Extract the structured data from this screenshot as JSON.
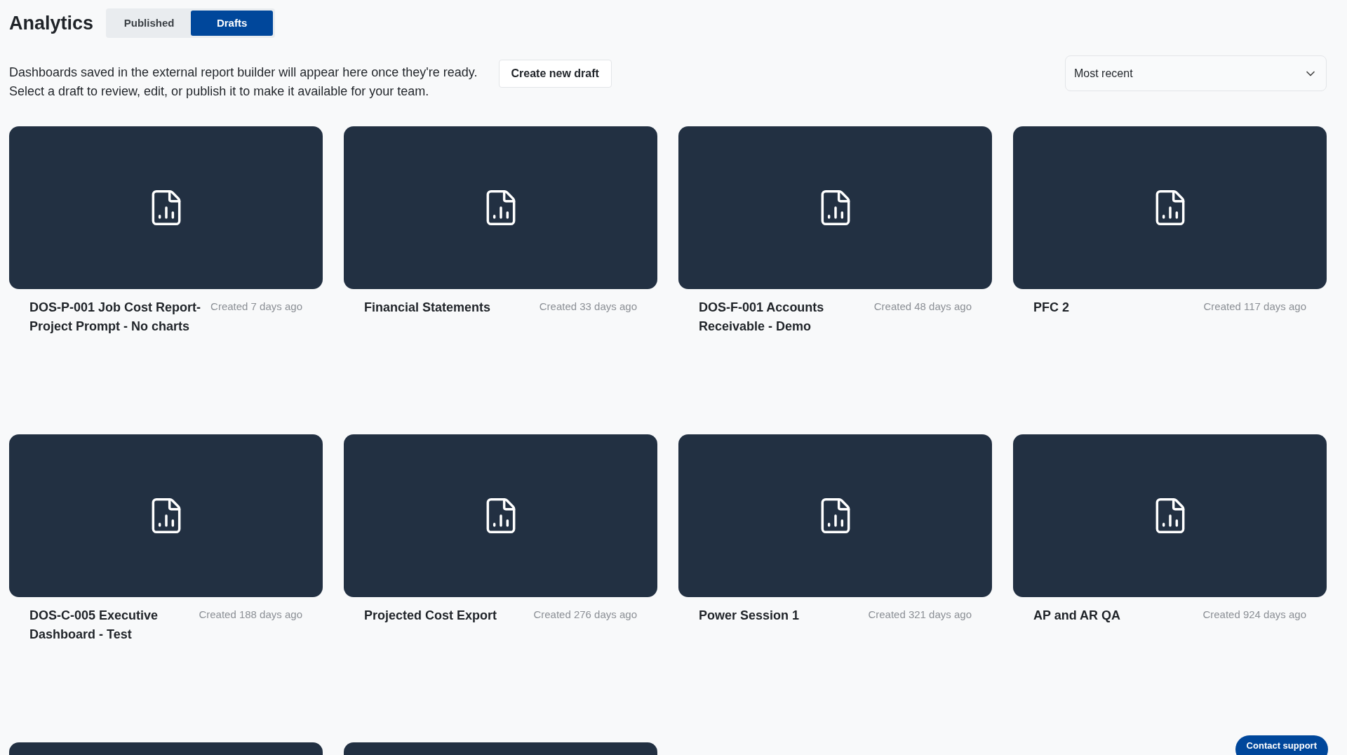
{
  "title": "Analytics",
  "tabs": [
    {
      "label": "Published",
      "selected": false
    },
    {
      "label": "Drafts",
      "selected": true
    }
  ],
  "description": [
    "Dashboards saved in the external report builder will appear here once they're ready.",
    "Select a draft to review, edit, or publish it to make it available for your team."
  ],
  "create_button": "Create new draft",
  "sort_select": {
    "value": "Most recent"
  },
  "cards": [
    {
      "kind": "full",
      "title": "DOS-P-001 Job Cost Report- Project Prompt - No charts",
      "created": "Created 7 days ago"
    },
    {
      "kind": "full",
      "title": "Financial Statements",
      "created": "Created 33 days ago"
    },
    {
      "kind": "full",
      "title": "DOS-F-001 Accounts Receivable - Demo",
      "created": "Created 48 days ago"
    },
    {
      "kind": "full",
      "title": "PFC 2",
      "created": "Created 117 days ago"
    },
    {
      "kind": "full",
      "title": "DOS-C-005 Executive Dashboard - Test",
      "created": "Created 188 days ago"
    },
    {
      "kind": "full",
      "title": "Projected Cost Export",
      "created": "Created 276 days ago"
    },
    {
      "kind": "full",
      "title": "Power Session 1",
      "created": "Created 321 days ago"
    },
    {
      "kind": "full",
      "title": "AP and AR QA",
      "created": "Created 924 days ago"
    },
    {
      "kind": "cut"
    },
    {
      "kind": "cut"
    }
  ],
  "support_button": "Contact support"
}
